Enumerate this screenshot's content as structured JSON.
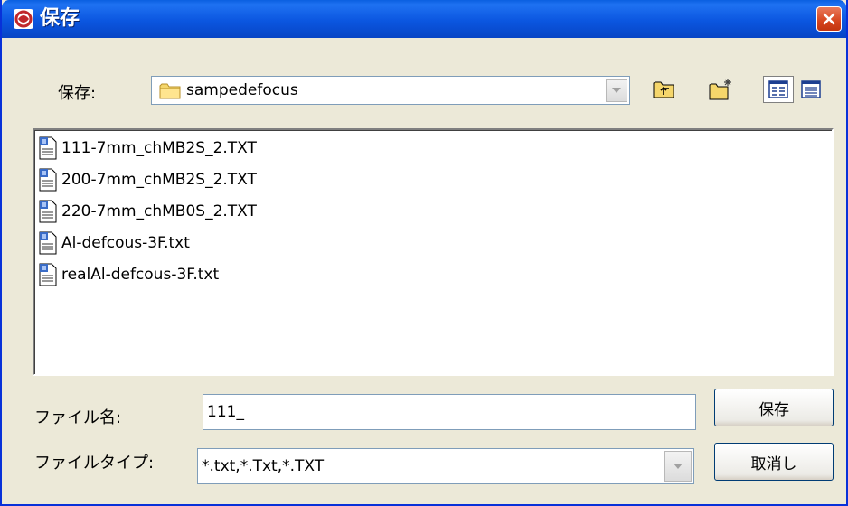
{
  "window": {
    "title": "保存",
    "icon": "app-icon"
  },
  "save_in": {
    "label": "保存:",
    "value": "sampedefocus",
    "folder_icon": "folder-icon"
  },
  "toolbar": {
    "up_icon": "up-folder-icon",
    "new_folder_icon": "new-folder-icon",
    "list_view_icon": "list-view-icon",
    "details_view_icon": "details-view-icon"
  },
  "files": [
    {
      "name": "111-7mm_chMB2S_2.TXT"
    },
    {
      "name": "200-7mm_chMB2S_2.TXT"
    },
    {
      "name": "220-7mm_chMB0S_2.TXT"
    },
    {
      "name": "Al-defcous-3F.txt"
    },
    {
      "name": "realAl-defcous-3F.txt"
    }
  ],
  "filename": {
    "label": "ファイル名:",
    "value": "111_"
  },
  "filetype": {
    "label": "ファイルタイプ:",
    "value": "*.txt,*.Txt,*.TXT"
  },
  "buttons": {
    "save": "保存",
    "cancel": "取消し"
  },
  "colors": {
    "titlebar": "#0b56e0",
    "close": "#d6441d",
    "background": "#ece9d8"
  }
}
